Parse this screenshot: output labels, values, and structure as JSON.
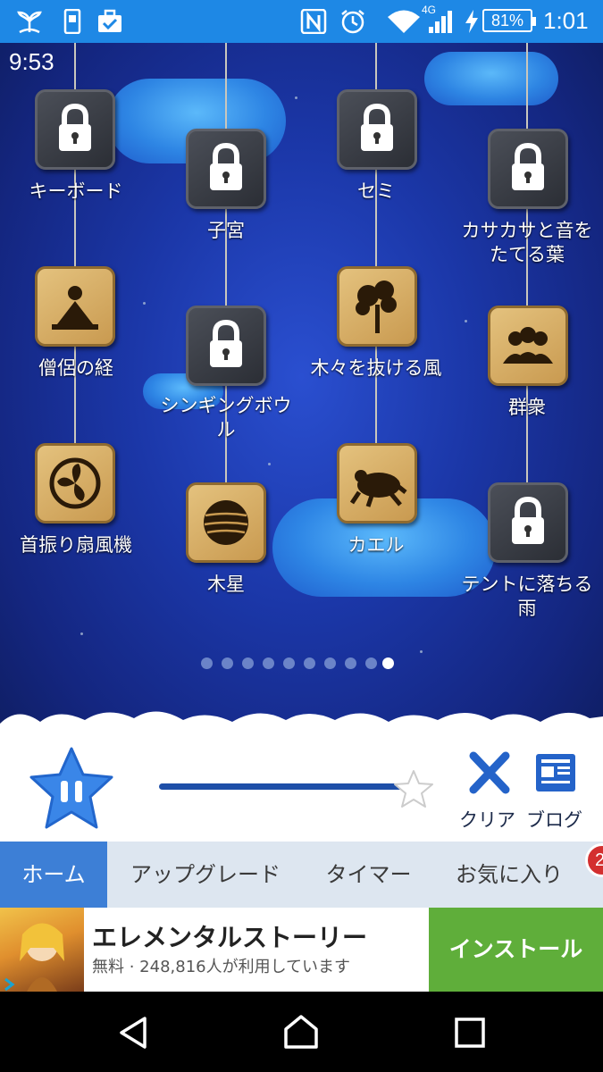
{
  "status_bar": {
    "icons_left": [
      "sprout-icon",
      "phone-icon",
      "briefcase-check-icon"
    ],
    "icons_right": [
      "nfc-icon",
      "alarm-icon",
      "wifi-icon",
      "signal-icon",
      "charging-icon"
    ],
    "network": "4G",
    "battery": "81%",
    "time": "1:01"
  },
  "overlay_time": "9:53",
  "sounds": [
    {
      "label": "キーボード",
      "locked": true,
      "icon": "lock-icon"
    },
    {
      "label": "子宮",
      "locked": true,
      "icon": "lock-icon"
    },
    {
      "label": "セミ",
      "locked": true,
      "icon": "lock-icon"
    },
    {
      "label": "カサカサと音をたてる葉",
      "locked": true,
      "icon": "lock-icon"
    },
    {
      "label": "僧侶の経",
      "locked": false,
      "icon": "monk-icon"
    },
    {
      "label": "シンギングボウル",
      "locked": true,
      "icon": "lock-icon"
    },
    {
      "label": "木々を抜ける風",
      "locked": false,
      "icon": "tree-icon"
    },
    {
      "label": "群衆",
      "locked": false,
      "icon": "crowd-icon"
    },
    {
      "label": "首振り扇風機",
      "locked": false,
      "icon": "fan-icon"
    },
    {
      "label": "木星",
      "locked": false,
      "icon": "jupiter-icon"
    },
    {
      "label": "カエル",
      "locked": false,
      "icon": "frog-icon"
    },
    {
      "label": "テントに落ちる雨",
      "locked": true,
      "icon": "lock-icon"
    }
  ],
  "label_lines": {
    "l0": "キーボード",
    "l1": "子宮",
    "l2": "セミ",
    "l3a": "カサカサと音を",
    "l3b": "たてる葉",
    "l4": "僧侶の経",
    "l5a": "シンギングボウ",
    "l5b": "ル",
    "l6": "木々を抜ける風",
    "l7": "群衆",
    "l8": "首振り扇風機",
    "l9": "木星",
    "l10": "カエル",
    "l11a": "テントに落ちる",
    "l11b": "雨"
  },
  "pagination": {
    "pages": 10,
    "current": 10
  },
  "player": {
    "pause_icon": "pause-icon",
    "volume_level": 0.95,
    "clear_label": "クリア",
    "blog_label": "ブログ"
  },
  "tabs": {
    "home": "ホーム",
    "upgrade": "アップグレード",
    "timer": "タイマー",
    "favorites": "お気に入り",
    "badge": "2"
  },
  "ad": {
    "title": "エレメンタルストーリー",
    "subtitle": "無料 · 248,816人が利用しています",
    "install": "インストール"
  },
  "colors": {
    "status_bar": "#1e88e5",
    "active_tab": "#3d7fd6",
    "install_button": "#5fae3a",
    "badge": "#d32f2f"
  }
}
